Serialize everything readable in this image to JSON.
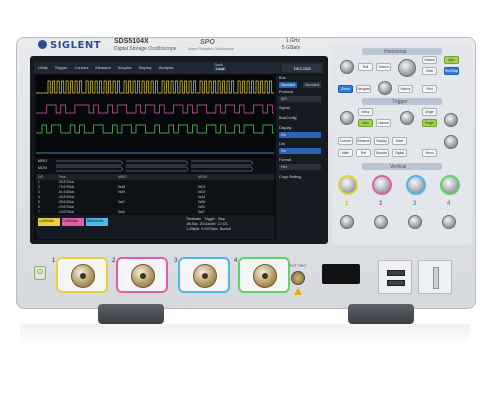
{
  "instrument": {
    "brand": "SIGLENT",
    "model": "SDS5104X",
    "subtitle": "Digital Storage Oscilloscope",
    "tech_logo": "SPO",
    "tech_sub": "Super Phosphor Oscilloscope",
    "bandwidth": "1 GHz",
    "sample_rate": "5 GSa/s"
  },
  "menu": {
    "items": [
      "Utility",
      "Trigger",
      "Cursors",
      "Measure",
      "Acquire",
      "Display",
      "Analysis"
    ],
    "clock_label": "Clock",
    "clock_value": "Local",
    "decode_label": "DECODE"
  },
  "right_panel": {
    "bus": "Bus",
    "modes": [
      "Decoded",
      "Decoded"
    ],
    "protocol_label": "Protocol",
    "protocol_value": "SPI",
    "signal_label": "Signal",
    "busconfig_label": "BusConfig",
    "display_label": "Display",
    "display_value": "On",
    "list_label": "List",
    "list_value": "On",
    "format_label": "Format",
    "format_value": "Hex",
    "copy_label": "Copy Setting"
  },
  "decode_table": {
    "headers": [
      "NO.",
      "Time",
      "MISO",
      "MOSI"
    ],
    "rows": [
      [
        "1",
        "-99.8700us",
        "",
        ""
      ],
      [
        "2",
        "-79.6790us",
        "0xA8",
        "0xD2"
      ],
      [
        "3",
        "-61.6180us",
        "0x49",
        "0xD3"
      ],
      [
        "4",
        "-49.8100us",
        "",
        "0xA4"
      ],
      [
        "5",
        "-39.6130us",
        "0xd7",
        "0xB6"
      ],
      [
        "6",
        "-19.6700us",
        "",
        "0x00"
      ],
      [
        "7",
        "-19.6700us",
        "0xd2",
        "0xd7"
      ]
    ]
  },
  "bus_labels": [
    "MISO",
    "MOSI"
  ],
  "status": {
    "ch1": "1.00V/div",
    "ch2": "1.00V/div",
    "ch3": "500mV/div",
    "trig_labels": [
      "Timebase",
      "Trigger",
      "Stop"
    ],
    "trig_values": [
      "-86.5us",
      "20.0us/div",
      "1.25kpts",
      "5.00GSa/s",
      "C1 DC",
      "Normal"
    ]
  },
  "panel": {
    "horizontal": "Horizontal",
    "trigger": "Trigger",
    "vertical": "Vertical",
    "buttons": [
      "Default",
      "Auto",
      "Run/Stop",
      "Single",
      "Clear Sweep",
      "Roll",
      "Search",
      "Setup",
      "Auto",
      "Normal",
      "Single",
      "Zoom",
      "Navigate",
      "History",
      "Cursors",
      "Measure",
      "Display",
      "Math",
      "Ref",
      "Decode",
      "Digital",
      "Menu",
      "Print",
      "Save"
    ],
    "channels": [
      "1",
      "2",
      "3",
      "4"
    ]
  },
  "front": {
    "channels": [
      "1",
      "2",
      "3",
      "4"
    ],
    "power_icon": "power-icon",
    "ext_trig": "EXT TRIG"
  },
  "colors": {
    "ch1": "#e8d23a",
    "ch2": "#e060a8",
    "ch3": "#4fb7e6",
    "ch4": "#5fd16a",
    "accent": "#2f7fd8"
  }
}
